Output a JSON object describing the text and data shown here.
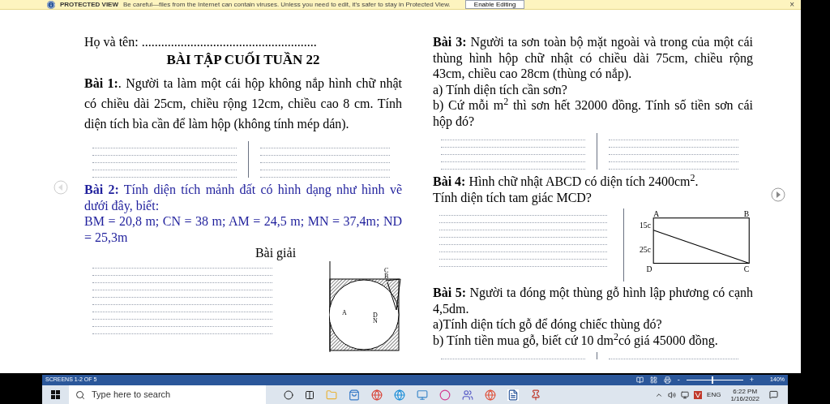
{
  "protected_view": {
    "label": "PROTECTED VIEW",
    "message": "Be careful—files from the Internet can contain viruses. Unless you need to edit, it's safer to stay in Protected View.",
    "button": "Enable Editing",
    "close": "×"
  },
  "left_column": [
    {
      "kind": "name_line",
      "text": "Họ và tên: ......................................................"
    },
    {
      "kind": "title",
      "text": "BÀI TẬP CUỐI TUẦN 22"
    },
    {
      "kind": "paragraph",
      "spaced": true,
      "text": "**Bài 1:**. Người ta làm một cái hộp không nắp hình chữ nhật có chiều dài 25cm, chiều rộng 12cm, chiều cao 8 cm. Tính diện tích bìa cần để làm hộp (không tính mép dán)."
    },
    {
      "kind": "lines_split"
    },
    {
      "kind": "paragraph",
      "blue": true,
      "text": "**Bài 2:** Tính diện tích mảnh đất có hình dạng như hình vẽ dưới đây, biết:"
    },
    {
      "kind": "paragraph",
      "blue": true,
      "text": "BM = 20,8 m; CN = 38 m; AM = 24,5 m; MN = 37,4m; ND = 25,3m"
    },
    {
      "kind": "heading",
      "text": "Bài giải"
    },
    {
      "kind": "lines_circle_figure",
      "labels": [
        "C",
        "B",
        "A",
        "D",
        "N"
      ]
    }
  ],
  "right_column": [
    {
      "kind": "paragraph",
      "text": "**Bài 3:** Người ta sơn toàn bộ mặt ngoài và trong của một cái thùng hình hộp chữ nhật có chiều dài 75cm, chiều rộng 43cm, chiều cao 28cm (thùng có nắp)."
    },
    {
      "kind": "paragraph",
      "text": "a) Tính diện tích cần sơn?"
    },
    {
      "kind": "paragraph",
      "text": "b) Cứ mỗi m$^{2}$ thì sơn hết 32000 đồng. Tính số tiền sơn cái hộp đó?"
    },
    {
      "kind": "lines_split"
    },
    {
      "kind": "paragraph",
      "text": "**Bài 4:** Hình chữ nhật ABCD có diện tích 2400cm$^{2}$."
    },
    {
      "kind": "paragraph",
      "text": "Tính diện tích tam giác MCD?"
    },
    {
      "kind": "lines_rect_figure",
      "labels": [
        "A",
        "B",
        "15c",
        "25c",
        "D",
        "C"
      ]
    },
    {
      "kind": "paragraph",
      "text": "**Bài 5:** Người ta đóng một thùng gỗ hình lập phương có cạnh 4,5dm."
    },
    {
      "kind": "paragraph",
      "text": "a)Tính diện tích gỗ để đóng chiếc thùng đó?"
    },
    {
      "kind": "paragraph",
      "text": "b) Tính tiền mua gỗ, biết cứ 10 dm$^{2}$có giá 45000 đồng."
    },
    {
      "kind": "lines_split_short"
    }
  ],
  "status_bar": {
    "screens": "SCREENS 1-2 OF 5",
    "zoom_out": "-",
    "zoom_in": "+",
    "zoom": {
      "level": 0.45
    },
    "zoom_label": "140%"
  },
  "taskbar": {
    "search_placeholder": "Type here to search",
    "language": "ENG",
    "time": "6:22 PM",
    "date": "1/16/2022"
  }
}
